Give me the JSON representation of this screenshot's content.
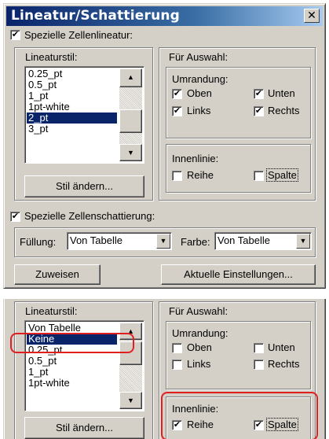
{
  "dialog": {
    "title": "Lineatur/Schattierung",
    "close_glyph": "✕"
  },
  "colors": {
    "title_start": "#0a246a",
    "title_end": "#a6caf0",
    "highlight": "#e02020",
    "selection": "#0a246a"
  },
  "special_lines": {
    "checked_glyph": "✔",
    "label": "Spezielle Zellenlineatur:"
  },
  "line_style": {
    "label": "Lineaturstil:",
    "items": [
      "0.25_pt",
      "0.5_pt",
      "1_pt",
      "1pt-white",
      "2_pt",
      "3_pt"
    ],
    "selected": "2_pt",
    "change_button": "Stil ändern..."
  },
  "selection_group": {
    "label": "Für Auswahl:",
    "border_label": "Umrandung:",
    "top": "Oben",
    "bottom": "Unten",
    "left": "Links",
    "right": "Rechts",
    "inner_label": "Innenlinie:",
    "row": "Reihe",
    "column": "Spalte"
  },
  "special_shading": {
    "label": "Spezielle Zellenschattierung:"
  },
  "fill": {
    "label": "Füllung:",
    "value": "Von Tabelle"
  },
  "color": {
    "label": "Farbe:",
    "value": "Von Tabelle"
  },
  "assign_button": "Zuweisen",
  "current_settings_button": "Aktuelle Einstellungen...",
  "second_panel": {
    "line_style_label": "Lineaturstil:",
    "items": [
      "Von Tabelle",
      "Keine",
      "0.25_pt",
      "0.5_pt",
      "1_pt",
      "1pt-white"
    ],
    "selected": "Keine",
    "change_button": "Stil ändern...",
    "selection_label": "Für Auswahl:",
    "border_label": "Umrandung:",
    "top": "Oben",
    "bottom": "Unten",
    "left": "Links",
    "right": "Rechts",
    "inner_label": "Innenlinie:",
    "row": "Reihe",
    "column": "Spalte",
    "checked_glyph": "✔"
  }
}
